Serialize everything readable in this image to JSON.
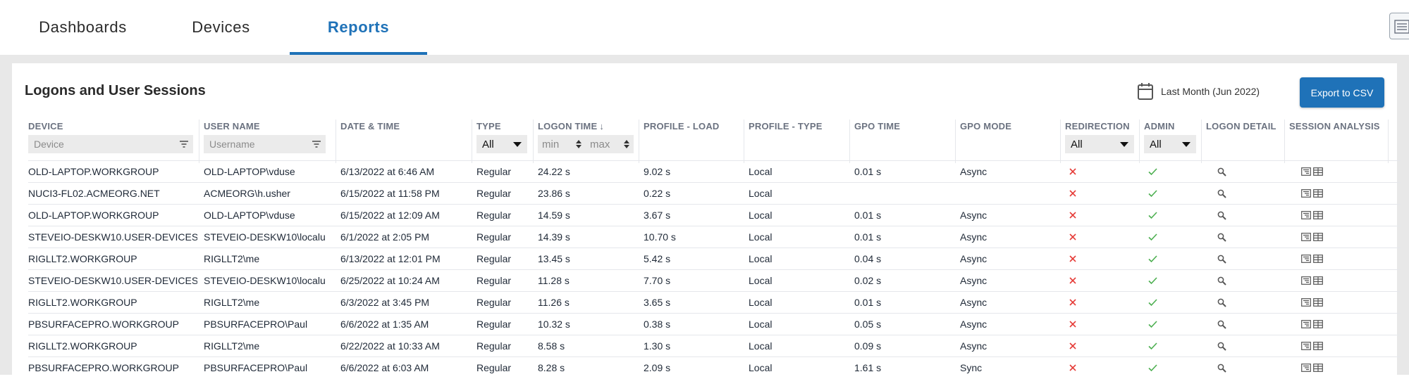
{
  "nav": {
    "tabs": [
      {
        "label": "Dashboards",
        "active": false
      },
      {
        "label": "Devices",
        "active": false
      },
      {
        "label": "Reports",
        "active": true
      }
    ],
    "settings_icon": "sliders-icon"
  },
  "panel": {
    "title": "Logons and User Sessions",
    "date_range": "Last Month (Jun 2022)",
    "date_icon": "calendar-icon",
    "export_label": "Export to CSV"
  },
  "columns": [
    {
      "key": "device",
      "label": "DEVICE"
    },
    {
      "key": "user",
      "label": "USER NAME"
    },
    {
      "key": "datetime",
      "label": "DATE & TIME"
    },
    {
      "key": "type",
      "label": "TYPE"
    },
    {
      "key": "logon",
      "label": "LOGON TIME",
      "sort": "descending"
    },
    {
      "key": "profile_load",
      "label": "PROFILE - LOAD"
    },
    {
      "key": "profile_type",
      "label": "PROFILE - TYPE"
    },
    {
      "key": "gpo_time",
      "label": "GPO TIME"
    },
    {
      "key": "gpo_mode",
      "label": "GPO MODE"
    },
    {
      "key": "redirection",
      "label": "REDIRECTION"
    },
    {
      "key": "admin",
      "label": "ADMIN"
    },
    {
      "key": "logon_detail",
      "label": "LOGON DETAIL"
    },
    {
      "key": "session_analysis",
      "label": "SESSION ANALYSIS"
    }
  ],
  "filters": {
    "device_placeholder": "Device",
    "user_placeholder": "Username",
    "type_value": "All",
    "logon_min_placeholder": "min",
    "logon_max_placeholder": "max",
    "redirection_value": "All",
    "admin_value": "All"
  },
  "status_colors": {
    "cross": "#e53935",
    "check": "#4caf50",
    "accent": "#1f72b8"
  },
  "rows": [
    {
      "device": "OLD-LAPTOP.WORKGROUP",
      "user": "OLD-LAPTOP\\vduse",
      "datetime": "6/13/2022 at 6:46 AM",
      "type": "Regular",
      "logon": "24.22 s",
      "profile_load": "9.02 s",
      "profile_type": "Local",
      "gpo_time": "0.01 s",
      "gpo_mode": "Async",
      "redirection": false,
      "admin": true
    },
    {
      "device": "NUCI3-FL02.ACMEORG.NET",
      "user": "ACMEORG\\h.usher",
      "datetime": "6/15/2022 at 11:58 PM",
      "type": "Regular",
      "logon": "23.86 s",
      "profile_load": "0.22 s",
      "profile_type": "Local",
      "gpo_time": "",
      "gpo_mode": "",
      "redirection": false,
      "admin": true
    },
    {
      "device": "OLD-LAPTOP.WORKGROUP",
      "user": "OLD-LAPTOP\\vduse",
      "datetime": "6/15/2022 at 12:09 AM",
      "type": "Regular",
      "logon": "14.59 s",
      "profile_load": "3.67 s",
      "profile_type": "Local",
      "gpo_time": "0.01 s",
      "gpo_mode": "Async",
      "redirection": false,
      "admin": true
    },
    {
      "device": "STEVEIO-DESKW10.USER-DEVICES",
      "user": "STEVEIO-DESKW10\\localu",
      "datetime": "6/1/2022 at 2:05 PM",
      "type": "Regular",
      "logon": "14.39 s",
      "profile_load": "10.70 s",
      "profile_type": "Local",
      "gpo_time": "0.01 s",
      "gpo_mode": "Async",
      "redirection": false,
      "admin": true
    },
    {
      "device": "RIGLLT2.WORKGROUP",
      "user": "RIGLLT2\\me",
      "datetime": "6/13/2022 at 12:01 PM",
      "type": "Regular",
      "logon": "13.45 s",
      "profile_load": "5.42 s",
      "profile_type": "Local",
      "gpo_time": "0.04 s",
      "gpo_mode": "Async",
      "redirection": false,
      "admin": true
    },
    {
      "device": "STEVEIO-DESKW10.USER-DEVICES",
      "user": "STEVEIO-DESKW10\\localu",
      "datetime": "6/25/2022 at 10:24 AM",
      "type": "Regular",
      "logon": "11.28 s",
      "profile_load": "7.70 s",
      "profile_type": "Local",
      "gpo_time": "0.02 s",
      "gpo_mode": "Async",
      "redirection": false,
      "admin": true
    },
    {
      "device": "RIGLLT2.WORKGROUP",
      "user": "RIGLLT2\\me",
      "datetime": "6/3/2022 at 3:45 PM",
      "type": "Regular",
      "logon": "11.26 s",
      "profile_load": "3.65 s",
      "profile_type": "Local",
      "gpo_time": "0.01 s",
      "gpo_mode": "Async",
      "redirection": false,
      "admin": true
    },
    {
      "device": "PBSURFACEPRO.WORKGROUP",
      "user": "PBSURFACEPRO\\Paul",
      "datetime": "6/6/2022 at 1:35 AM",
      "type": "Regular",
      "logon": "10.32 s",
      "profile_load": "0.38 s",
      "profile_type": "Local",
      "gpo_time": "0.05 s",
      "gpo_mode": "Async",
      "redirection": false,
      "admin": true
    },
    {
      "device": "RIGLLT2.WORKGROUP",
      "user": "RIGLLT2\\me",
      "datetime": "6/22/2022 at 10:33 AM",
      "type": "Regular",
      "logon": "8.58 s",
      "profile_load": "1.30 s",
      "profile_type": "Local",
      "gpo_time": "0.09 s",
      "gpo_mode": "Async",
      "redirection": false,
      "admin": true
    },
    {
      "device": "PBSURFACEPRO.WORKGROUP",
      "user": "PBSURFACEPRO\\Paul",
      "datetime": "6/6/2022 at 6:03 AM",
      "type": "Regular",
      "logon": "8.28 s",
      "profile_load": "2.09 s",
      "profile_type": "Local",
      "gpo_time": "1.61 s",
      "gpo_mode": "Sync",
      "redirection": false,
      "admin": true
    }
  ],
  "row_icons": {
    "redirection_false": "cross-icon",
    "admin_true": "checkmark-icon",
    "logon_detail": "magnifier-icon",
    "session_analysis": [
      "tree-icon",
      "table-icon"
    ]
  }
}
